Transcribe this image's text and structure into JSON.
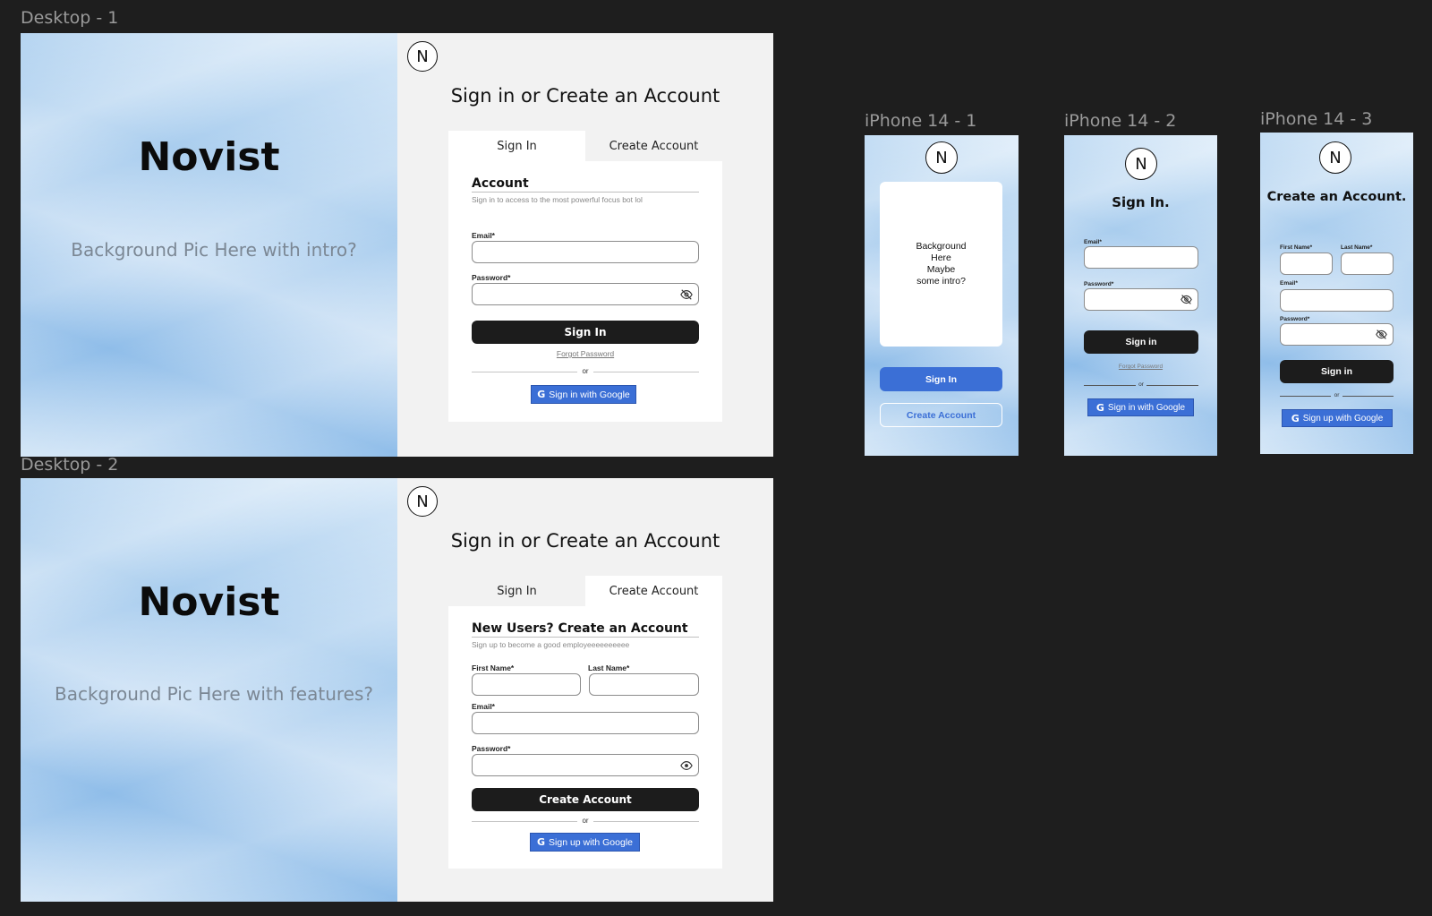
{
  "frames": {
    "desktop1": "Desktop - 1",
    "desktop2": "Desktop - 2",
    "iphone1": "iPhone 14 - 1",
    "iphone2": "iPhone 14 - 2",
    "iphone3": "iPhone 14 - 3"
  },
  "logo_letter": "N",
  "desktop1": {
    "brand": "Novist",
    "intro": "Background Pic Here with intro?",
    "heading": "Sign in or Create an Account",
    "tabs": [
      "Sign In",
      "Create Account"
    ],
    "active_tab": "Sign In",
    "card_title": "Account",
    "card_subtitle": "Sign in to access to the most powerful focus bot lol",
    "email_label": "Email*",
    "password_label": "Password*",
    "submit": "Sign In",
    "forgot": "Forgot Password",
    "or": "or",
    "google": "Sign in with Google"
  },
  "desktop2": {
    "brand": "Novist",
    "intro": "Background Pic Here with features?",
    "heading": "Sign in or Create an Account",
    "tabs": [
      "Sign In",
      "Create Account"
    ],
    "active_tab": "Create Account",
    "card_title": "New Users? Create an Account",
    "card_subtitle": "Sign up to become a good employeeeeeeeeee",
    "first_name_label": "First Name*",
    "last_name_label": "Last  Name*",
    "email_label": "Email*",
    "password_label": "Password*",
    "submit": "Create Account",
    "or": "or",
    "google": "Sign up with Google"
  },
  "iphone1": {
    "card_text": [
      "Background",
      "Here",
      "Maybe",
      "some intro?"
    ],
    "sign_in": "Sign In",
    "create": "Create Account"
  },
  "iphone2": {
    "title": "Sign In.",
    "email_label": "Email*",
    "password_label": "Password*",
    "submit": "Sign in",
    "forgot": "Forgot Password",
    "or": "or",
    "google": "Sign in with Google"
  },
  "iphone3": {
    "title": "Create an Account.",
    "first_name_label": "First Name*",
    "last_name_label": "Last Name*",
    "email_label": "Email*",
    "password_label": "Password*",
    "submit": "Sign in",
    "or": "or",
    "google": "Sign up with Google"
  },
  "colors": {
    "canvas": "#1e1e1e",
    "panel": "#f2f2f2",
    "dark_button": "#1c1c1c",
    "google_blue": "#3b6fd6"
  },
  "icons": [
    "eye-off-icon",
    "eye-icon",
    "google-g-icon"
  ]
}
